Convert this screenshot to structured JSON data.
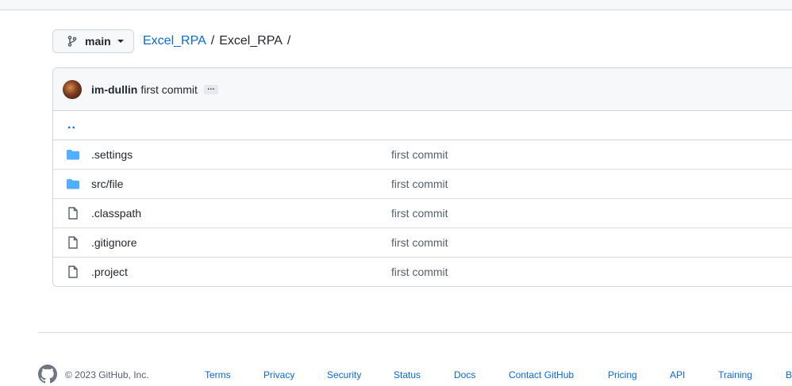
{
  "branch": {
    "name": "main",
    "branch_icon": "git-branch-icon",
    "caret_icon": "triangle-down-icon"
  },
  "breadcrumb": {
    "repo": "Excel_RPA",
    "sep1": "/",
    "dir": "Excel_RPA",
    "sep2": "/"
  },
  "commit": {
    "author": "im-dullin",
    "message": "first commit",
    "ellipsis": "…"
  },
  "parent_dir": "..",
  "files": [
    {
      "name": ".settings",
      "type": "folder",
      "icon": "folder-icon",
      "message": "first commit"
    },
    {
      "name": "src/file",
      "type": "folder",
      "icon": "folder-icon",
      "message": "first commit"
    },
    {
      "name": ".classpath",
      "type": "file",
      "icon": "file-icon",
      "message": "first commit"
    },
    {
      "name": ".gitignore",
      "type": "file",
      "icon": "file-icon",
      "message": "first commit"
    },
    {
      "name": ".project",
      "type": "file",
      "icon": "file-icon",
      "message": "first commit"
    }
  ],
  "footer": {
    "copyright": "© 2023 GitHub, Inc.",
    "links": [
      "Terms",
      "Privacy",
      "Security",
      "Status",
      "Docs",
      "Contact GitHub",
      "Pricing",
      "API",
      "Training",
      "Blog"
    ]
  },
  "colors": {
    "link": "#0969da",
    "folder": "#54aeff",
    "border": "#d0d7de"
  }
}
